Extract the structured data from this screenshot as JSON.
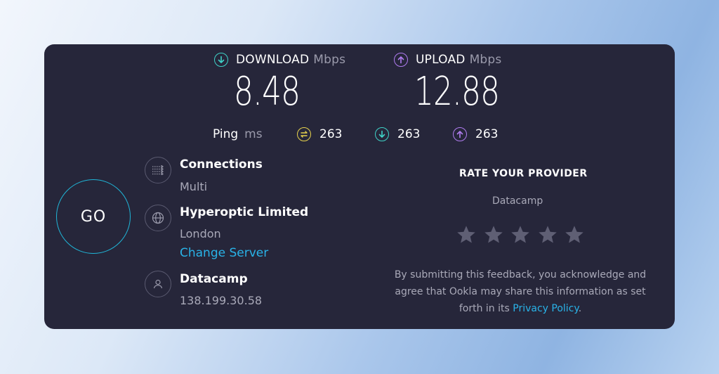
{
  "download": {
    "label": "DOWNLOAD",
    "unit": "Mbps",
    "value": "8.48",
    "color": "#3fd3c8"
  },
  "upload": {
    "label": "UPLOAD",
    "unit": "Mbps",
    "value": "12.88",
    "color": "#b07cf0"
  },
  "ping": {
    "label": "Ping",
    "unit": "ms",
    "idle": "263",
    "download": "263",
    "upload": "263",
    "idle_color": "#e7d24c"
  },
  "go_label": "GO",
  "connections": {
    "title": "Connections",
    "value": "Multi"
  },
  "server": {
    "title": "Hyperoptic Limited",
    "location": "London",
    "change_label": "Change Server"
  },
  "provider": {
    "title": "Datacamp",
    "ip": "138.199.30.58"
  },
  "rate": {
    "title": "RATE YOUR PROVIDER",
    "provider": "Datacamp",
    "stars": 5,
    "disclaimer_line1": "By submitting this feedback, you acknowledge and",
    "disclaimer_line2": "agree that Ookla may share this information as set",
    "disclaimer_line3_prefix": "forth in its ",
    "privacy_link": "Privacy Policy",
    "disclaimer_line3_suffix": "."
  },
  "colors": {
    "card": "#26263a",
    "accent": "#29b3e8",
    "go_ring": "#20b6d8"
  }
}
